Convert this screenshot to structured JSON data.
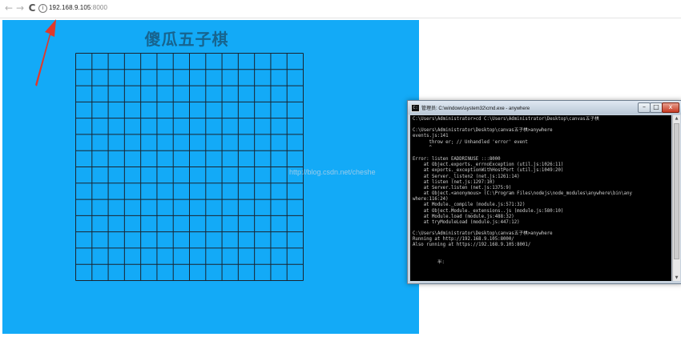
{
  "browser": {
    "back_icon": "arrow-left-icon",
    "forward_icon": "arrow-right-icon",
    "reload_icon": "reload-icon",
    "info_icon": "info-icon",
    "url_host": "192.168.9.105",
    "url_port": ":8000"
  },
  "page": {
    "background": "#13aaf7",
    "title": "傻瓜五子棋",
    "board": {
      "rows": 14,
      "cols": 14,
      "line_color": "#1a2430"
    }
  },
  "annotation": {
    "arrow_color": "#e0392b"
  },
  "console": {
    "title": "管理员: C:\\windows\\system32\\cmd.exe - anywhere",
    "min_label": "–",
    "max_label": "□",
    "close_label": "x",
    "lines": [
      "C:\\Users\\Administrator>cd C:\\Users\\Administrator\\Desktop\\canvas五子棋",
      "",
      "C:\\Users\\Administrator\\Desktop\\canvas五子棋>anywhere",
      "events.js:141",
      "      throw er; // Unhandled 'error' event",
      "      ^",
      "",
      "Error: listen EADDRINUSE :::8000",
      "    at Object.exports._errnoException (util.js:1026:11)",
      "    at exports._exceptionWithHostPort (util.js:1049:20)",
      "    at Server._listen2 (net.js:1261:14)",
      "    at listen (net.js:1297:10)",
      "    at Server.listen (net.js:1375:9)",
      "    at Object.<anonymous> (C:\\Program Files\\nodejs\\node_modules\\anywhere\\bin\\any",
      "where:116:24)",
      "    at Module._compile (module.js:571:32)",
      "    at Object.Module._extensions..js (module.js:580:10)",
      "    at Module.load (module.js:488:32)",
      "    at tryModuleLoad (module.js:447:12)",
      "",
      "C:\\Users\\Administrator\\Desktop\\canvas五子棋>anywhere",
      "Running at http://192.168.9.105:8000/",
      "Also running at https://192.168.9.105:8001/",
      "",
      "",
      "         半:"
    ]
  },
  "watermark": "http://blog.csdn.net/cheshe"
}
